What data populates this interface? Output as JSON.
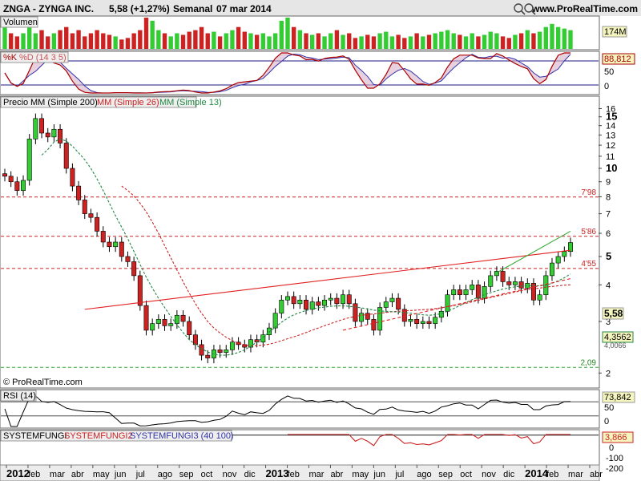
{
  "header": {
    "symbol": "ZNGA - ZYNGA INC.",
    "quote": "5,58 (+1,27%)",
    "period": "Semanal",
    "date": "07 mar 2014",
    "site": "www.ProRealTime.com",
    "watermark": "© ProRealTime.com"
  },
  "panels": {
    "volume": {
      "label": "Volumen",
      "badge": "174M"
    },
    "stoch": {
      "label_k": "%K",
      "label_d": "%D (14 3 5)",
      "badge": "88,812",
      "ticks": [
        "50",
        "0"
      ]
    },
    "price": {
      "label": "Precio",
      "ma200": "MM (Simple 200)",
      "ma26": "MM (Simple 26)",
      "ma13": "MM (Simple 13)",
      "price_badge": "5,58",
      "ma_badge": "4,3562",
      "ma_badge2": "4,0066"
    },
    "rsi": {
      "label": "RSI (14)",
      "badge": "73,842",
      "ticks": [
        "50",
        "0"
      ]
    },
    "sysfungi": {
      "label1": "SYSTEMFUNGI",
      "label2": "SYSTEMFUNGI2",
      "label3": "SYSTEMFUNGI3 (40 100)",
      "badge": "3,866",
      "ticks": [
        "0",
        "-100",
        "-200"
      ]
    }
  },
  "levels": [
    {
      "text": "7'98",
      "value": 7.98
    },
    {
      "text": "5'86",
      "value": 5.86
    },
    {
      "text": "4'55",
      "value": 4.55
    },
    {
      "text": "2,09",
      "value": 2.09
    }
  ],
  "colors": {
    "up": "#33cc33",
    "down": "#cc2222",
    "stoch_k": "#aa0000",
    "stoch_d": "#3333aa",
    "ma26": "#cc2222",
    "ma13": "#228844",
    "trend": "#e02020",
    "hline": "#1a1a80",
    "badge_fill": "#f5f5c0"
  },
  "chart_data": {
    "type": "candlestick",
    "title": "ZNGA - ZYNGA INC.",
    "timeframe": "Semanal",
    "x_month_labels": [
      "2012",
      "feb",
      "mar",
      "abr",
      "may",
      "jun",
      "jul",
      "ago",
      "sep",
      "oct",
      "nov",
      "dic",
      "2013",
      "feb",
      "mar",
      "abr",
      "may",
      "jun",
      "jul",
      "ago",
      "sep",
      "oct",
      "nov",
      "dic",
      "2014",
      "feb",
      "mar",
      "abr"
    ],
    "y_ticks": [
      "16",
      "15",
      "14",
      "13",
      "12",
      "11",
      "10",
      "9",
      "8",
      "7",
      "6",
      "5",
      "4",
      "3",
      "2"
    ],
    "y_scale": "log",
    "ylim": [
      1.8,
      17.2
    ],
    "last_close": 5.58,
    "close": [
      9.4,
      9.0,
      8.4,
      9.1,
      12.6,
      14.8,
      13.2,
      12.8,
      13.6,
      12.2,
      10.0,
      8.7,
      7.8,
      7.0,
      6.8,
      6.1,
      5.6,
      5.4,
      5.6,
      5.0,
      4.8,
      4.3,
      3.4,
      2.8,
      2.95,
      3.05,
      2.9,
      2.95,
      3.15,
      3.0,
      2.7,
      2.5,
      2.3,
      2.25,
      2.4,
      2.35,
      2.4,
      2.55,
      2.5,
      2.45,
      2.6,
      2.55,
      2.7,
      2.85,
      3.2,
      3.55,
      3.65,
      3.45,
      3.55,
      3.3,
      3.5,
      3.4,
      3.55,
      3.6,
      3.45,
      3.7,
      3.45,
      3.0,
      3.2,
      3.05,
      2.8,
      3.35,
      3.5,
      3.6,
      3.3,
      3.0,
      3.05,
      2.95,
      3.0,
      2.95,
      3.1,
      3.25,
      3.7,
      3.85,
      3.7,
      3.85,
      4.0,
      3.6,
      3.95,
      4.3,
      4.45,
      4.1,
      4.0,
      4.1,
      3.9,
      4.05,
      3.55,
      3.7,
      4.3,
      4.75,
      5.0,
      5.2,
      5.58
    ],
    "ma13": [
      null,
      null,
      null,
      null,
      null,
      null,
      11.1,
      11.6,
      12.3,
      12.6,
      12.4,
      11.9,
      11.3,
      10.7,
      10.0,
      9.2,
      8.4,
      7.6,
      6.9,
      6.3,
      5.75,
      5.2,
      4.7,
      4.25,
      3.9,
      3.6,
      3.35,
      3.12,
      2.92,
      2.75,
      2.6,
      2.5,
      2.42,
      2.36,
      2.32,
      2.3,
      2.3,
      2.32,
      2.35,
      2.4,
      2.47,
      2.55,
      2.65,
      2.76,
      2.87,
      2.98,
      3.08,
      3.16,
      3.22,
      3.27,
      3.31,
      3.34,
      3.36,
      3.38,
      3.39,
      3.39,
      3.38,
      3.36,
      3.34,
      3.31,
      3.28,
      3.26,
      3.25,
      3.24,
      3.23,
      3.22,
      3.2,
      3.18,
      3.16,
      3.15,
      3.16,
      3.19,
      3.25,
      3.32,
      3.4,
      3.48,
      3.56,
      3.63,
      3.7,
      3.76,
      3.82,
      3.87,
      3.91,
      3.94,
      3.96,
      3.97,
      3.97,
      3.97,
      3.99,
      4.05,
      4.13,
      4.23,
      4.36
    ],
    "ma26": [
      null,
      null,
      null,
      null,
      null,
      null,
      null,
      null,
      null,
      null,
      null,
      null,
      null,
      null,
      null,
      null,
      null,
      null,
      null,
      8.7,
      8.4,
      8.05,
      7.6,
      7.1,
      6.55,
      6.0,
      5.45,
      4.95,
      4.5,
      4.1,
      3.75,
      3.45,
      3.2,
      3.0,
      2.85,
      2.74,
      2.65,
      2.58,
      2.53,
      2.5,
      2.48,
      2.48,
      2.49,
      2.51,
      2.54,
      2.58,
      2.62,
      2.66,
      2.7,
      2.75,
      2.8,
      2.85,
      2.9,
      2.95,
      3.0,
      3.05,
      3.09,
      3.12,
      3.15,
      3.17,
      3.18,
      3.2,
      3.22,
      3.24,
      3.25,
      3.26,
      3.27,
      3.28,
      3.29,
      3.3,
      3.32,
      3.34,
      3.37,
      3.4,
      3.43,
      3.46,
      3.5,
      3.54,
      3.58,
      3.62,
      3.66,
      3.7,
      3.74,
      3.78,
      3.82,
      3.86,
      3.88,
      3.9,
      3.93,
      3.95,
      3.97,
      3.99,
      4.0
    ],
    "volume": [
      1.0,
      0.5,
      0.4,
      0.5,
      0.7,
      0.5,
      0.6,
      0.4,
      0.5,
      0.6,
      0.7,
      0.5,
      0.6,
      0.4,
      0.5,
      0.6,
      0.5,
      0.45,
      0.4,
      0.3,
      0.35,
      0.5,
      0.6,
      1.0,
      0.9,
      0.6,
      0.5,
      0.4,
      0.5,
      0.45,
      0.55,
      0.6,
      0.7,
      0.5,
      0.55,
      0.4,
      0.5,
      0.6,
      0.7,
      0.55,
      0.5,
      0.45,
      0.5,
      0.4,
      0.5,
      0.9,
      1.0,
      0.7,
      0.6,
      0.5,
      0.45,
      0.5,
      0.4,
      0.5,
      0.6,
      0.45,
      0.5,
      0.35,
      0.4,
      0.45,
      0.4,
      0.5,
      0.55,
      0.4,
      0.45,
      0.35,
      0.4,
      0.5,
      0.4,
      0.45,
      0.5,
      0.55,
      0.6,
      0.5,
      0.45,
      0.4,
      0.5,
      0.4,
      0.45,
      0.55,
      0.5,
      0.4,
      0.35,
      0.45,
      0.5,
      0.6,
      0.5,
      0.55,
      0.7,
      0.8,
      0.7,
      0.65,
      0.6
    ],
    "trendline_upper": [
      {
        "x": 13,
        "y": 3.3
      },
      {
        "x": 92,
        "y": 5.25
      }
    ],
    "trendline_lower": [
      {
        "x": 55,
        "y": 2.8
      },
      {
        "x": 92,
        "y": 4.2
      }
    ],
    "breakout_line": [
      {
        "x": 80,
        "y": 4.4
      },
      {
        "x": 92,
        "y": 6.1
      }
    ]
  }
}
